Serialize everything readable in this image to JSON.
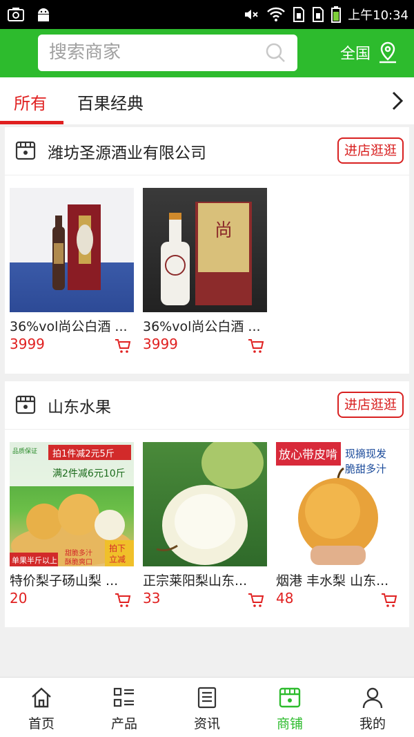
{
  "statusbar": {
    "time": "上午10:34"
  },
  "search": {
    "placeholder": "搜索商家"
  },
  "region": {
    "label": "全国"
  },
  "tabs": [
    {
      "label": "所有",
      "active": true
    },
    {
      "label": "百果经典",
      "active": false
    }
  ],
  "stores": [
    {
      "name": "潍坊圣源酒业有限公司",
      "enter_label": "进店逛逛",
      "products": [
        {
          "name": "36%vol尚公白酒 ...",
          "price": "3999"
        },
        {
          "name": "36%vol尚公白酒 ...",
          "price": "3999"
        }
      ]
    },
    {
      "name": "山东水果",
      "enter_label": "进店逛逛",
      "products": [
        {
          "name": "特价梨子砀山梨 ...",
          "price": "20",
          "img_text": {
            "t1": "拍1件减2元5斤",
            "t2": "满2件减6元10斤",
            "t3": "单果半斤以上",
            "t4": "甜脆多汁",
            "t5": "酥脆爽口",
            "t6": "拍下",
            "t7": "立减",
            "logo": "品质保证"
          }
        },
        {
          "name": "正宗莱阳梨山东...",
          "price": "33"
        },
        {
          "name": "烟港 丰水梨 山东...",
          "price": "48",
          "img_text": {
            "t1": "放心带皮啃",
            "t2": "现摘现发",
            "t3": "脆甜多汁"
          }
        }
      ]
    }
  ],
  "nav": [
    {
      "label": "首页",
      "icon": "home-icon",
      "active": false
    },
    {
      "label": "产品",
      "icon": "list-icon",
      "active": false
    },
    {
      "label": "资讯",
      "icon": "news-icon",
      "active": false
    },
    {
      "label": "商铺",
      "icon": "shop-icon",
      "active": true
    },
    {
      "label": "我的",
      "icon": "user-icon",
      "active": false
    }
  ],
  "colors": {
    "brand_green": "#2dbb2d",
    "accent_red": "#e02020"
  }
}
